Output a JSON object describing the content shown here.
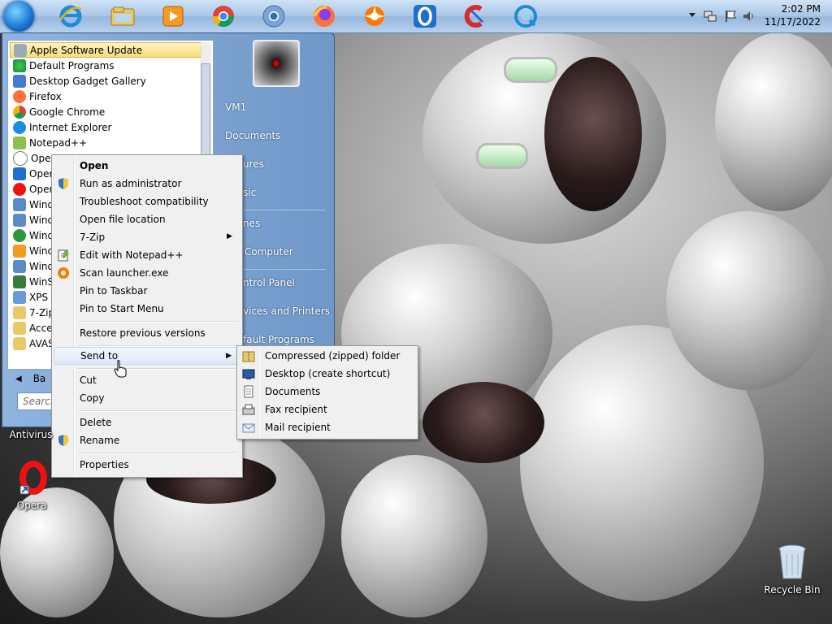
{
  "taskbar": {
    "icons": [
      "windows-start-orb",
      "internet-explorer-icon",
      "file-explorer-icon",
      "media-player-icon",
      "chrome-icon",
      "chrome-canary-icon",
      "firefox-icon",
      "avast-icon",
      "opera-icon",
      "ccleaner-icon",
      "quicktime-icon"
    ],
    "clock_time": "2:02 PM",
    "clock_date": "11/17/2022"
  },
  "start_menu": {
    "programs": [
      {
        "label": "Apple Software Update",
        "highlighted": true
      },
      {
        "label": "Default Programs"
      },
      {
        "label": "Desktop Gadget Gallery"
      },
      {
        "label": "Firefox"
      },
      {
        "label": "Google Chrome"
      },
      {
        "label": "Internet Explorer"
      },
      {
        "label": "Notepad++"
      },
      {
        "label": "Opera"
      },
      {
        "label": "Opera"
      },
      {
        "label": "Opera"
      },
      {
        "label": "Windo"
      },
      {
        "label": "Windo"
      },
      {
        "label": "Windo"
      },
      {
        "label": "Windo"
      },
      {
        "label": "Windo"
      },
      {
        "label": "WinSC"
      },
      {
        "label": "XPS V"
      },
      {
        "label": "7-Zip"
      },
      {
        "label": "Acces"
      },
      {
        "label": "AVAS"
      }
    ],
    "back_label": "Ba",
    "search_placeholder": "Search",
    "right_items": [
      "VM1",
      "Documents",
      "ures",
      "sic",
      "nes",
      "Computer",
      "ntrol Panel",
      "vices and Printers",
      "fault Programs"
    ]
  },
  "context_menu": {
    "items": [
      {
        "label": "Open",
        "bold": true
      },
      {
        "label": "Run as administrator",
        "icon": "shield-icon"
      },
      {
        "label": "Troubleshoot compatibility"
      },
      {
        "label": "Open file location"
      },
      {
        "label": "7-Zip",
        "submenu": true
      },
      {
        "label": "Edit with Notepad++",
        "icon": "notepad-icon"
      },
      {
        "label": "Scan launcher.exe",
        "icon": "avast-icon"
      },
      {
        "label": "Pin to Taskbar"
      },
      {
        "label": "Pin to Start Menu"
      },
      {
        "label": "Restore previous versions"
      },
      {
        "label": "Send to",
        "submenu": true,
        "highlighted": true
      },
      {
        "label": "Cut"
      },
      {
        "label": "Copy"
      },
      {
        "label": "Delete"
      },
      {
        "label": "Rename",
        "icon": "shield-icon"
      },
      {
        "label": "Properties"
      }
    ]
  },
  "send_to_menu": {
    "items": [
      {
        "label": "Compressed (zipped) folder",
        "icon": "zip-folder-icon"
      },
      {
        "label": "Desktop (create shortcut)",
        "icon": "desktop-icon"
      },
      {
        "label": "Documents",
        "icon": "documents-icon"
      },
      {
        "label": "Fax recipient",
        "icon": "fax-icon"
      },
      {
        "label": "Mail recipient",
        "icon": "mail-icon"
      }
    ]
  },
  "desktop": {
    "icons": [
      {
        "label": "Antivirus"
      },
      {
        "label": "Opera"
      },
      {
        "label": "Recycle Bin"
      }
    ]
  },
  "colors": {
    "highlight_bg": "#f8dd7a",
    "menu_bg": "#f0f0f0",
    "taskbar_bg": "#a9c6e6"
  }
}
